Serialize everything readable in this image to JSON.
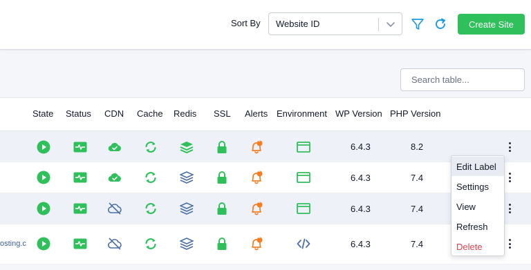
{
  "toolbar": {
    "sort_label": "Sort By",
    "sort_value": "Website ID",
    "create_label": "Create Site",
    "filter_icon": "filter-icon",
    "refresh_icon": "refresh-icon"
  },
  "search": {
    "placeholder": "Search table..."
  },
  "table": {
    "headers": [
      "State",
      "Status",
      "CDN",
      "Cache",
      "Redis",
      "SSL",
      "Alerts",
      "Environment",
      "WP Version",
      "PHP Version"
    ],
    "rows": [
      {
        "domain": "",
        "state": "running",
        "cdn": "on",
        "environment": "browser-window",
        "alert_count": "1",
        "wp": "6.4.3",
        "php": "8.2"
      },
      {
        "domain": "",
        "state": "running",
        "cdn": "on",
        "environment": "browser-window",
        "alert_count": "1",
        "wp": "6.4.3",
        "php": "7.4"
      },
      {
        "domain": "",
        "state": "running",
        "cdn": "off",
        "environment": "browser-window",
        "alert_count": "1",
        "wp": "6.4.3",
        "php": "7.4"
      },
      {
        "domain": "osting.c",
        "state": "running",
        "cdn": "off",
        "environment": "code",
        "alert_count": "1",
        "wp": "6.4.3",
        "php": "7.4"
      }
    ]
  },
  "context_menu": {
    "items": [
      "Edit Label",
      "Settings",
      "View",
      "Refresh",
      "Delete"
    ]
  },
  "colors": {
    "green": "#2fbf5b",
    "orange": "#f57c1f",
    "slate": "#4a6fa5",
    "danger": "#e0434f"
  }
}
